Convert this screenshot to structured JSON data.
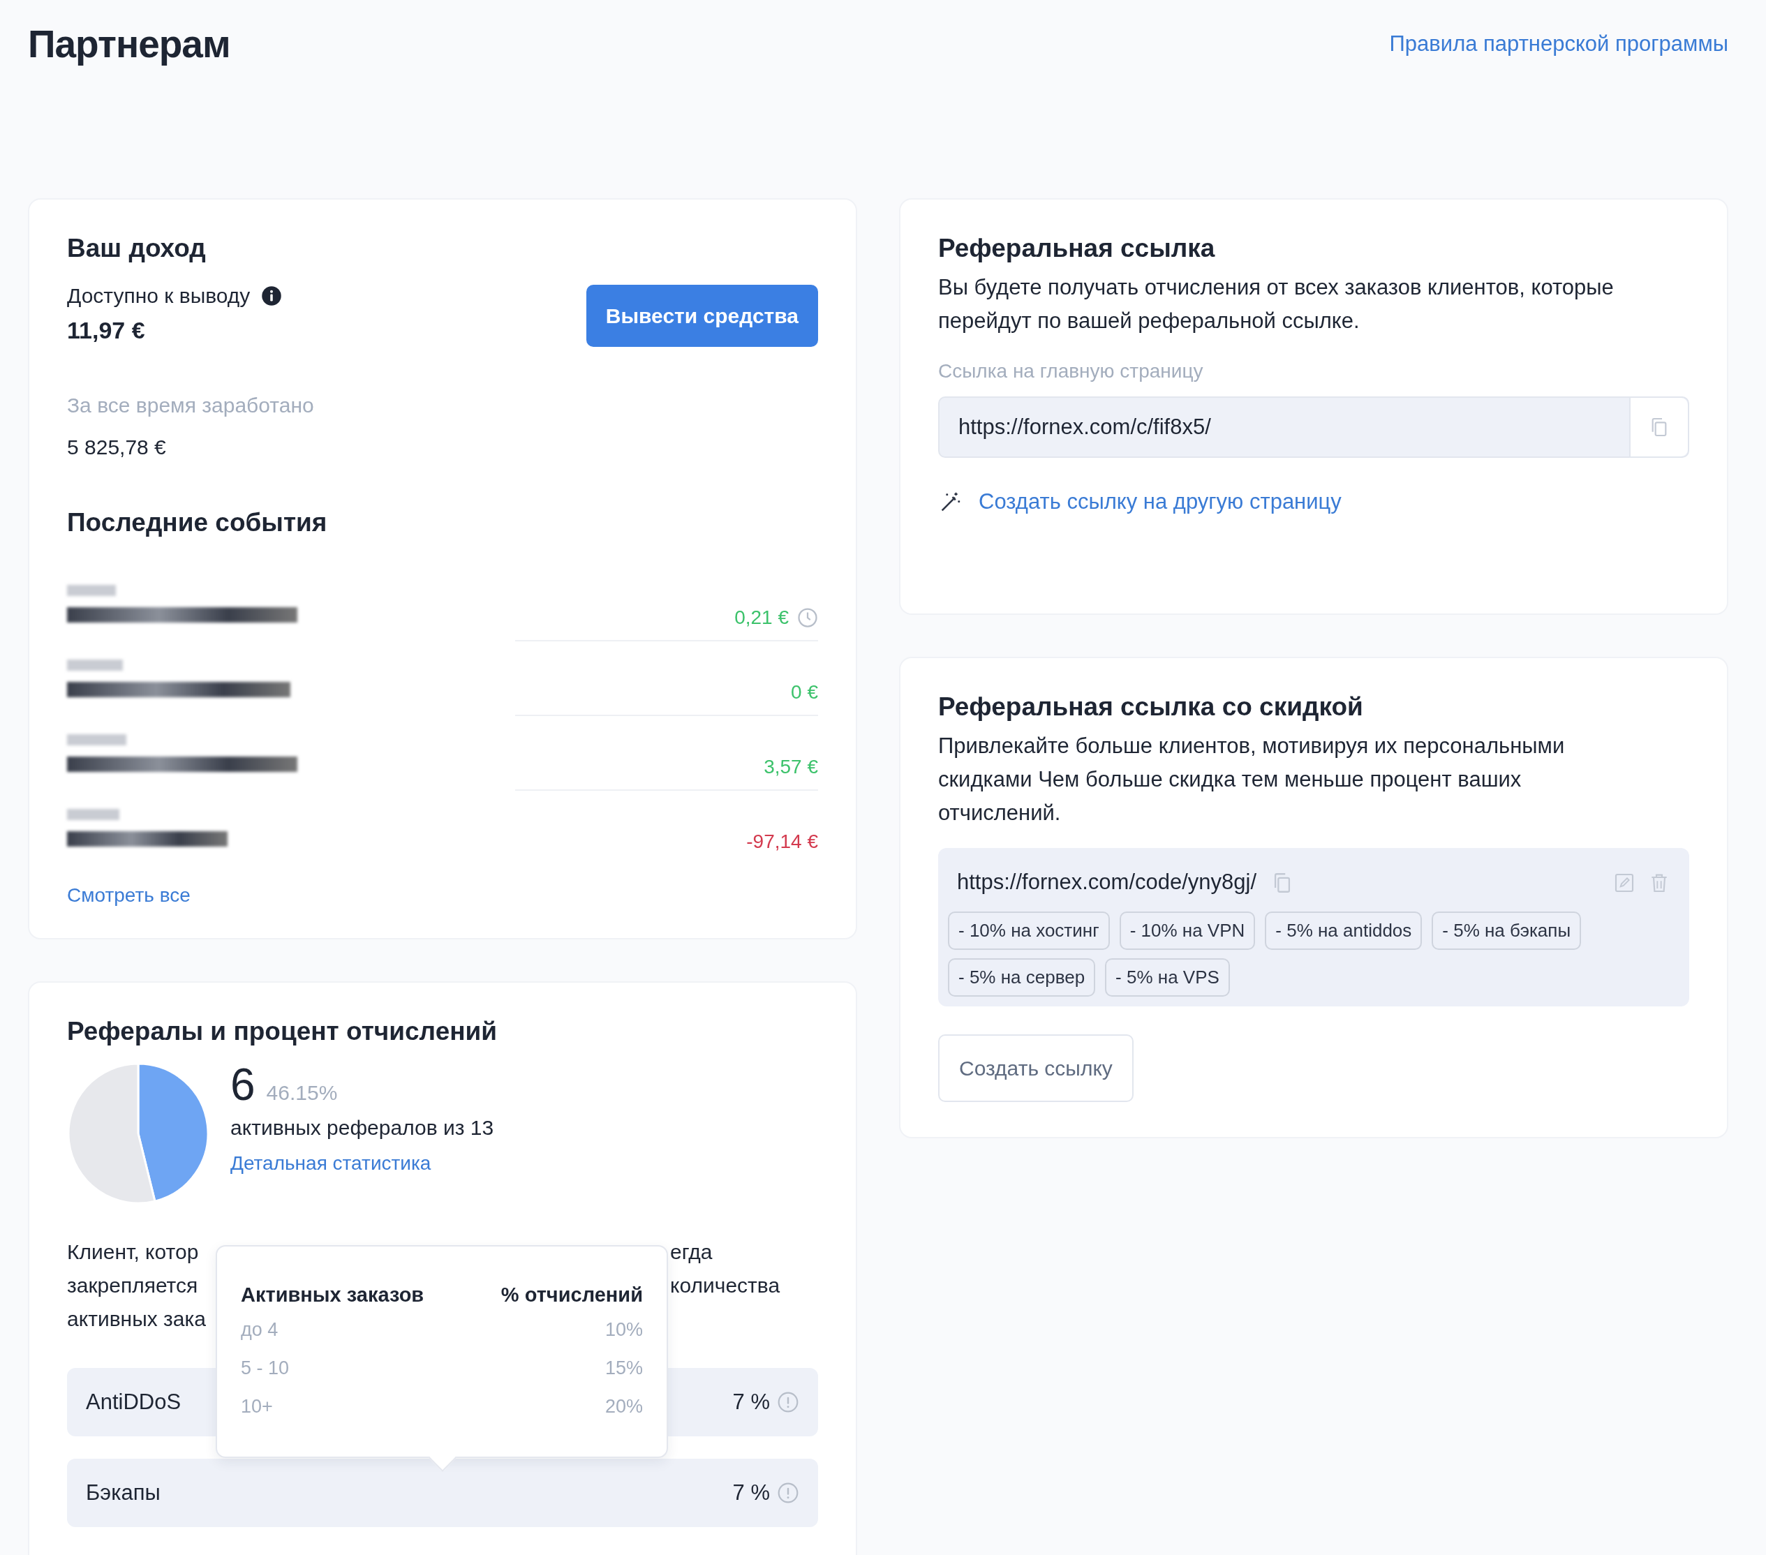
{
  "page": {
    "title": "Партнерам",
    "rules_link": "Правила партнерской программы"
  },
  "income": {
    "title": "Ваш доход",
    "available_label": "Доступно к выводу",
    "available_amount": "11,97 €",
    "withdraw_button": "Вывести средства",
    "total_label": "За все время заработано",
    "total_amount": "5 825,78 €",
    "events_title": "Последние события",
    "events": [
      {
        "amount": "0,21 €",
        "kind": "credit",
        "pending": true
      },
      {
        "amount": "0 €",
        "kind": "credit",
        "pending": false
      },
      {
        "amount": "3,57 €",
        "kind": "credit",
        "pending": false
      },
      {
        "amount": "-97,14 €",
        "kind": "debit",
        "pending": false
      }
    ],
    "view_all": "Смотреть все"
  },
  "referrals": {
    "title": "Рефералы и процент отчислений",
    "chart_data": {
      "type": "pie",
      "values": [
        46.15,
        53.85
      ]
    },
    "count": "6",
    "percent": "46.15%",
    "caption": "активных рефералов из 13",
    "stats_link": "Детальная статистика",
    "note_lines": [
      {
        "left": "Клиент, котор",
        "right": "егда"
      },
      {
        "left": "закрепляется",
        "right": "количества"
      },
      {
        "left": "активных зака"
      }
    ],
    "services": [
      {
        "name": "AntiDDoS",
        "percent": "7 %"
      },
      {
        "name": "Бэкапы",
        "percent": "7 %"
      }
    ],
    "tooltip": {
      "columns": [
        "Активных заказов",
        "% отчислений"
      ],
      "rows": [
        [
          "до 4",
          "10%"
        ],
        [
          "5 - 10",
          "15%"
        ],
        [
          "10+",
          "20%"
        ]
      ]
    }
  },
  "referral_link": {
    "title": "Реферальная ссылка",
    "description": "Вы будете получать отчисления от всех заказов клиентов, которые перейдут по вашей реферальной ссылке.",
    "field_label": "Ссылка на главную страницу",
    "url": "https://fornex.com/c/fif8x5/",
    "create_other": "Создать ссылку на другую страницу"
  },
  "discount_link": {
    "title": "Реферальная ссылка со скидкой",
    "description": "Привлекайте больше клиентов, мотивируя их персональными скидками Чем больше скидка тем меньше процент ваших отчислений.",
    "url": "https://fornex.com/code/yny8gj/",
    "discounts": [
      "- 10% на хостинг",
      "- 10% на VPN",
      "- 5% на antiddos",
      "- 5% на бэкапы",
      "- 5% на сервер",
      "- 5% на VPS"
    ],
    "create_button": "Создать ссылку"
  }
}
